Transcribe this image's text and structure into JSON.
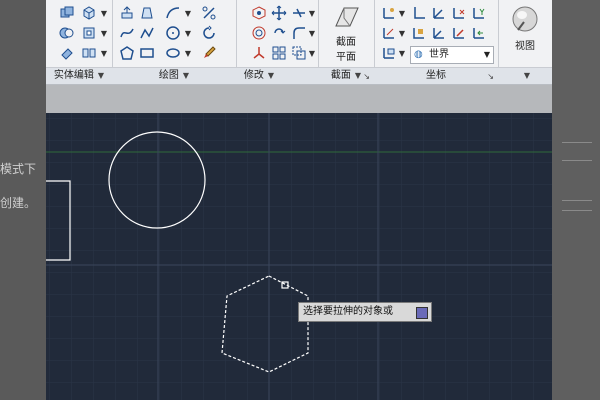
{
  "left_strip": {
    "lines": [
      "模式下",
      "创建。"
    ]
  },
  "ribbon": {
    "panels": [
      {
        "title": "实体编辑",
        "has_dropdown": true
      },
      {
        "title": "绘图",
        "has_dropdown": true
      },
      {
        "title": "修改",
        "has_dropdown": true
      },
      {
        "title": "截面",
        "has_dropdown": true
      },
      {
        "title": "坐标",
        "has_dropdown": false
      },
      {
        "title": "",
        "has_dropdown": true
      }
    ],
    "section_button": {
      "line1": "截面",
      "line2": "平面"
    },
    "ucs_select": {
      "value": "世界",
      "icon": "globe-icon"
    },
    "view_button": {
      "label": "视图",
      "icon": "view-sphere-icon"
    },
    "dropdown_glyph": "▼",
    "launcher_glyph": "↘"
  },
  "tooltip": {
    "text": "选择要拉伸的对象或"
  },
  "colors": {
    "viewport_bg": "#212a3a",
    "grid": "#2b3548",
    "grid_major": "#3a465c",
    "x_axis": "#2f6b3a",
    "geometry": "#ffffff"
  }
}
